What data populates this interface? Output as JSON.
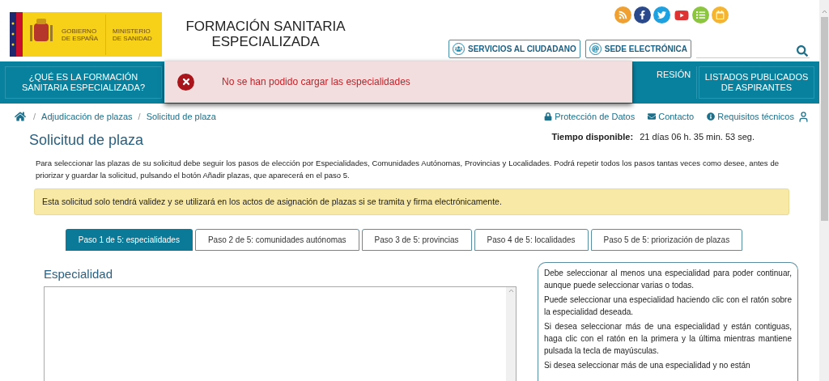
{
  "logo": {
    "government": "GOBIERNO DE ESPAÑA",
    "ministry": "MINISTERIO DE SANIDAD"
  },
  "site_title": "FORMACIÓN SANITARIA ESPECIALIZADA",
  "header_buttons": [
    {
      "kind": "people",
      "label": "SERVICIOS AL CIUDADANO"
    },
    {
      "kind": "at",
      "label": "SEDE ELECTRÓNICA"
    }
  ],
  "nav": [
    {
      "label": "¿QUÉ ES LA FORMACIÓN SANITARIA ESPECIALIZADA?"
    },
    {
      "label": "RESIÓN"
    },
    {
      "label": "LISTADOS PUBLICADOS DE ASPIRANTES"
    }
  ],
  "toast": {
    "message": "No se han podido cargar las especialidades"
  },
  "breadcrumb": [
    {
      "separator": "/",
      "label": "Adjudicación de plazas"
    },
    {
      "separator": "/",
      "label": "Solicitud de plaza"
    }
  ],
  "utility_links": [
    {
      "kind": "lock",
      "label": "Protección de Datos"
    },
    {
      "kind": "mail",
      "label": "Contacto"
    },
    {
      "kind": "info",
      "label": "Requisitos técnicos"
    }
  ],
  "page_title": "Solicitud de plaza",
  "time": {
    "label": "Tiempo disponible:",
    "value": "21 días 06 h. 35 min. 53 seg."
  },
  "intro": "Para seleccionar las plazas de su solicitud debe seguir los pasos de elección por Especialidades, Comunidades Autónomas, Provincias y Localidades. Podrá repetir todos los pasos tantas veces como desee, antes de priorizar y guardar la solicitud, pulsando el botón Añadir plazas, que aparecerá en el paso 5.",
  "notice": "Esta solicitud solo tendrá validez y se utilizará en los actos de asignación de plazas si se tramita y firma electrónicamente.",
  "steps": [
    {
      "label": "Paso 1 de 5: especialidades",
      "selected": true
    },
    {
      "label": "Paso 2 de 5: comunidades autónomas",
      "selected": false
    },
    {
      "label": "Paso 3 de 5: provincias",
      "selected": false
    },
    {
      "label": "Paso 4 de 5: localidades",
      "selected": false
    },
    {
      "label": "Paso 5 de 5: priorización de plazas",
      "selected": false
    }
  ],
  "section_title": "Especialidad",
  "help": [
    "Debe seleccionar al menos una especialidad para poder continuar, aunque puede seleccionar varias o todas.",
    "Puede seleccionar una especialidad haciendo clic con el ratón sobre la especialidad deseada.",
    "Si desea seleccionar más de una especialidad y están contiguas, haga clic con el ratón en la primera y la última mientras mantiene pulsada la tecla de mayúsculas.",
    "Si desea seleccionar más de una especialidad y no están"
  ]
}
